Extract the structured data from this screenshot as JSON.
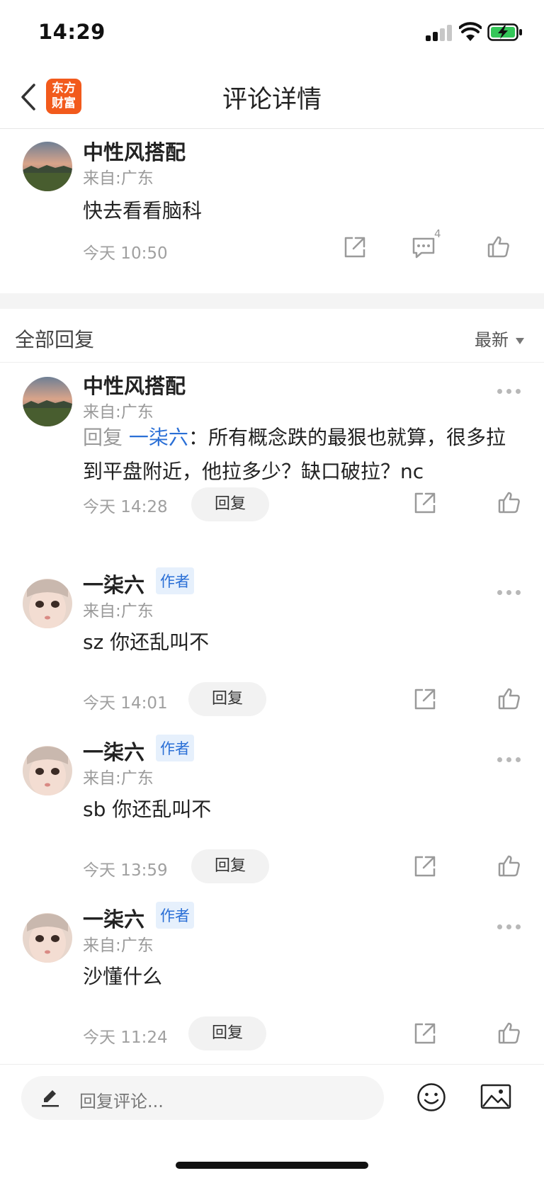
{
  "status_bar": {
    "time": "14:29"
  },
  "header": {
    "title": "评论详情",
    "logo_line1": "东方",
    "logo_line2": "财富"
  },
  "main_comment": {
    "username": "中性风搭配",
    "location": "来自:广东",
    "content": "快去看看脑科",
    "time": "今天 10:50",
    "reply_count": "4"
  },
  "replies_section": {
    "title": "全部回复",
    "sort_label": "最新"
  },
  "replies": [
    {
      "username": "中性风搭配",
      "location": "来自:广东",
      "reply_prefix": "回复",
      "reply_target": "一柒六",
      "content": "：所有概念跌的最狠也就算，很多拉到平盘附近，他拉多少？缺口破拉？nc",
      "time": "今天 14:28",
      "reply_button": "回复"
    },
    {
      "username": "一柒六",
      "badge": "作者",
      "location": "来自:广东",
      "content": "sz 你还乱叫不",
      "time": "今天 14:01",
      "reply_button": "回复"
    },
    {
      "username": "一柒六",
      "badge": "作者",
      "location": "来自:广东",
      "content": "sb 你还乱叫不",
      "time": "今天 13:59",
      "reply_button": "回复"
    },
    {
      "username": "一柒六",
      "badge": "作者",
      "location": "来自:广东",
      "content": "沙懂什么",
      "time": "今天 11:24",
      "reply_button": "回复"
    }
  ],
  "bottom_bar": {
    "input_placeholder": "回复评论..."
  },
  "colors": {
    "accent_blue": "#2a6fd6",
    "logo_orange": "#f25a1c",
    "battery_green": "#34c759"
  }
}
